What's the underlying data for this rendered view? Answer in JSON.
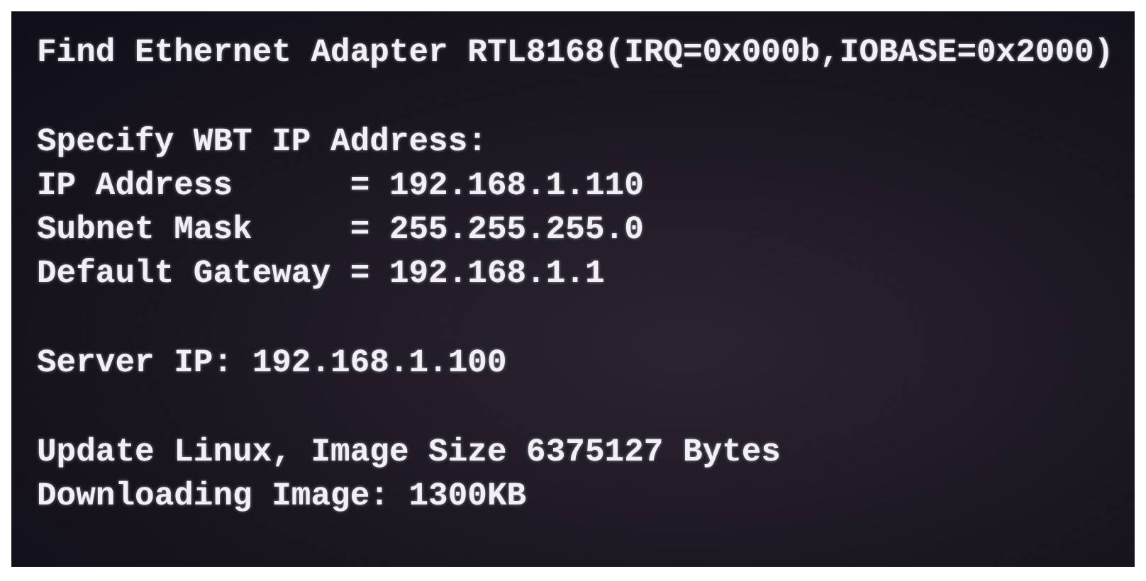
{
  "console": {
    "groups": [
      {
        "lines": [
          "Find Ethernet Adapter RTL8168(IRQ=0x000b,IOBASE=0x2000)"
        ]
      },
      {
        "lines": [
          "Specify WBT IP Address:",
          "IP Address      = 192.168.1.110",
          "Subnet Mask     = 255.255.255.0",
          "Default Gateway = 192.168.1.1"
        ]
      },
      {
        "lines": [
          "Server IP: 192.168.1.100"
        ]
      },
      {
        "lines": [
          "Update Linux, Image Size 6375127 Bytes",
          "Downloading Image: 1300KB"
        ]
      }
    ]
  }
}
